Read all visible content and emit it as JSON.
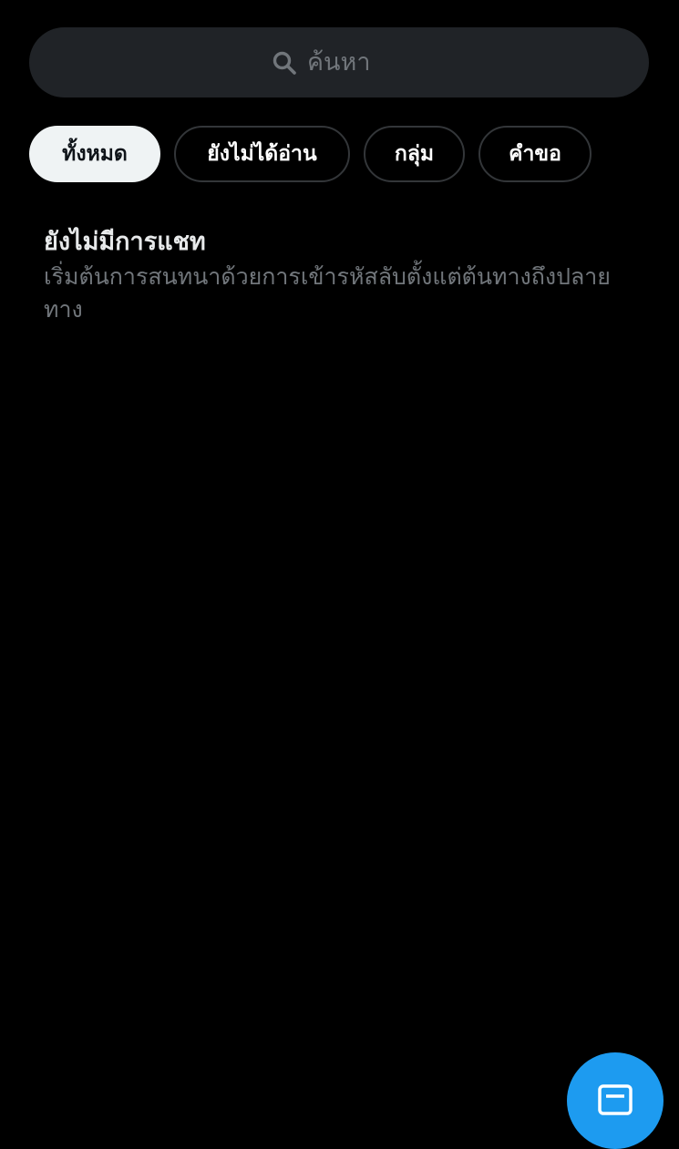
{
  "search": {
    "placeholder": "ค้นหา",
    "icon": "search-icon"
  },
  "filters": [
    {
      "label": "ทั้งหมด",
      "active": true
    },
    {
      "label": "ยังไม่ได้อ่าน",
      "active": false
    },
    {
      "label": "กลุ่ม",
      "active": false
    },
    {
      "label": "คำขอ",
      "active": false
    }
  ],
  "empty_state": {
    "title": "ยังไม่มีการแชท",
    "subtitle": "เริ่มต้นการสนทนาด้วยการเข้ารหัสลับตั้งแต่ต้นทางถึงปลายทาง"
  },
  "fab": {
    "icon": "new-message-icon",
    "color": "#1d9bf0"
  },
  "colors": {
    "background": "#000000",
    "search_background": "#202327",
    "active_chip": "#eff3f4",
    "secondary_text": "#71767b"
  }
}
